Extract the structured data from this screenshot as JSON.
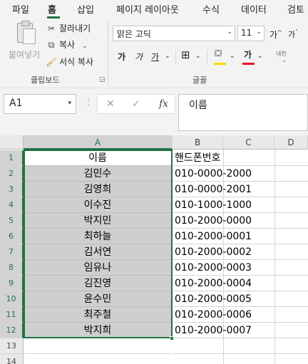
{
  "ribbon": {
    "tabs": [
      "파일",
      "홈",
      "삽입",
      "페이지 레이아웃",
      "수식",
      "데이터",
      "검토"
    ],
    "active_tab": "홈",
    "clipboard": {
      "paste_label": "붙여넣기",
      "cut_label": "잘라내기",
      "copy_label": "복사",
      "format_painter_label": "서식 복사",
      "group_label": "클립보드"
    },
    "font": {
      "font_name": "맑은 고딕",
      "font_size": "11",
      "grow_label": "가",
      "shrink_label": "가",
      "bold_label": "가",
      "italic_label": "가",
      "underline_label": "가",
      "font_color_label": "가",
      "phonetic_label": "내천",
      "group_label": "글꼴"
    },
    "accent_color": "#217346",
    "font_color_bar": "#e81123",
    "fill_color_bar": "#ffd800"
  },
  "formula_bar": {
    "name_box": "A1",
    "cancel_icon": "✕",
    "enter_icon": "✓",
    "fx_label": "fx",
    "content": "이름"
  },
  "sheet": {
    "columns": [
      "A",
      "B",
      "C",
      "D"
    ],
    "rows": [
      {
        "num": "1",
        "a": "이름",
        "b": "핸드폰번호"
      },
      {
        "num": "2",
        "a": "김민수",
        "b": "010-0000-2000"
      },
      {
        "num": "3",
        "a": "김영희",
        "b": "010-0000-2001"
      },
      {
        "num": "4",
        "a": "이수진",
        "b": "010-1000-1000"
      },
      {
        "num": "5",
        "a": "박지민",
        "b": "010-2000-0000"
      },
      {
        "num": "6",
        "a": "최하늘",
        "b": "010-2000-0001"
      },
      {
        "num": "7",
        "a": "김서연",
        "b": "010-2000-0002"
      },
      {
        "num": "8",
        "a": "임유나",
        "b": "010-2000-0003"
      },
      {
        "num": "9",
        "a": "김진영",
        "b": "010-2000-0004"
      },
      {
        "num": "10",
        "a": "윤수민",
        "b": "010-2000-0005"
      },
      {
        "num": "11",
        "a": "최주철",
        "b": "010-2000-0006"
      },
      {
        "num": "12",
        "a": "박지희",
        "b": "010-2000-0007"
      },
      {
        "num": "13",
        "a": "",
        "b": ""
      },
      {
        "num": "14",
        "a": "",
        "b": ""
      }
    ]
  }
}
